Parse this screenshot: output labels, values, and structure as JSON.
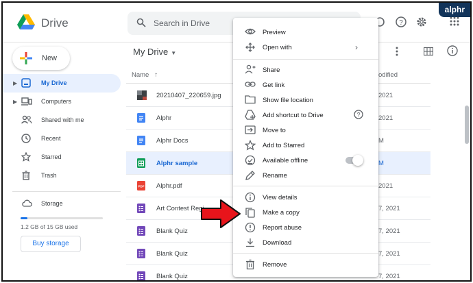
{
  "watermark": "alphr",
  "app": {
    "brand": "Drive"
  },
  "search": {
    "placeholder": "Search in Drive"
  },
  "sidebar": {
    "new_label": "New",
    "items": [
      {
        "label": "My Drive",
        "active": true,
        "expandable": true,
        "icon": "drive-icon"
      },
      {
        "label": "Computers",
        "active": false,
        "expandable": true,
        "icon": "computer-icon"
      },
      {
        "label": "Shared with me",
        "active": false,
        "expandable": false,
        "icon": "people-icon"
      },
      {
        "label": "Recent",
        "active": false,
        "expandable": false,
        "icon": "clock-icon"
      },
      {
        "label": "Starred",
        "active": false,
        "expandable": false,
        "icon": "star-icon"
      },
      {
        "label": "Trash",
        "active": false,
        "expandable": false,
        "icon": "trash-icon"
      }
    ],
    "storage": {
      "label": "Storage",
      "used_text": "1.2 GB of 15 GB used",
      "used_fraction": 0.08,
      "buy_label": "Buy storage"
    }
  },
  "main": {
    "title": "My Drive",
    "columns": {
      "name": "Name",
      "modified": "odified"
    },
    "files": [
      {
        "name": "20210407_220659.jpg",
        "type": "image",
        "modified": "2021",
        "selected": false
      },
      {
        "name": "Alphr",
        "type": "doc",
        "modified": "2021",
        "selected": false
      },
      {
        "name": "Alphr Docs",
        "type": "doc",
        "modified": "M",
        "selected": false
      },
      {
        "name": "Alphr sample",
        "type": "sheet",
        "modified": "M",
        "selected": true
      },
      {
        "name": "Alphr.pdf",
        "type": "pdf",
        "modified": "2021",
        "selected": false
      },
      {
        "name": "Art Contest Regi",
        "type": "form",
        "modified": "7, 2021",
        "selected": false
      },
      {
        "name": "Blank Quiz",
        "type": "form",
        "modified": "7, 2021",
        "selected": false
      },
      {
        "name": "Blank Quiz",
        "type": "form",
        "modified": "7, 2021",
        "selected": false
      },
      {
        "name": "Blank Quiz",
        "type": "form",
        "modified": "7, 2021",
        "selected": false
      }
    ]
  },
  "context_menu": {
    "items": [
      {
        "label": "Preview",
        "icon": "eye-icon"
      },
      {
        "label": "Open with",
        "icon": "move-arrows-icon",
        "submenu": true
      },
      {
        "label": "Share",
        "icon": "person-add-icon"
      },
      {
        "label": "Get link",
        "icon": "link-icon"
      },
      {
        "label": "Show file location",
        "icon": "folder-icon"
      },
      {
        "label": "Add shortcut to Drive",
        "icon": "shortcut-icon",
        "help": true
      },
      {
        "label": "Move to",
        "icon": "move-to-icon"
      },
      {
        "label": "Add to Starred",
        "icon": "star-icon"
      },
      {
        "label": "Available offline",
        "icon": "offline-icon",
        "toggle": false
      },
      {
        "label": "Rename",
        "icon": "pencil-icon"
      },
      {
        "label": "View details",
        "icon": "info-icon"
      },
      {
        "label": "Make a copy",
        "icon": "copy-icon"
      },
      {
        "label": "Report abuse",
        "icon": "report-icon"
      },
      {
        "label": "Download",
        "icon": "download-icon"
      },
      {
        "label": "Remove",
        "icon": "trash-icon"
      }
    ]
  },
  "colors": {
    "accent": "#1a73e8",
    "selected_bg": "#e8f0fe",
    "arrow_red": "#e8141b"
  }
}
